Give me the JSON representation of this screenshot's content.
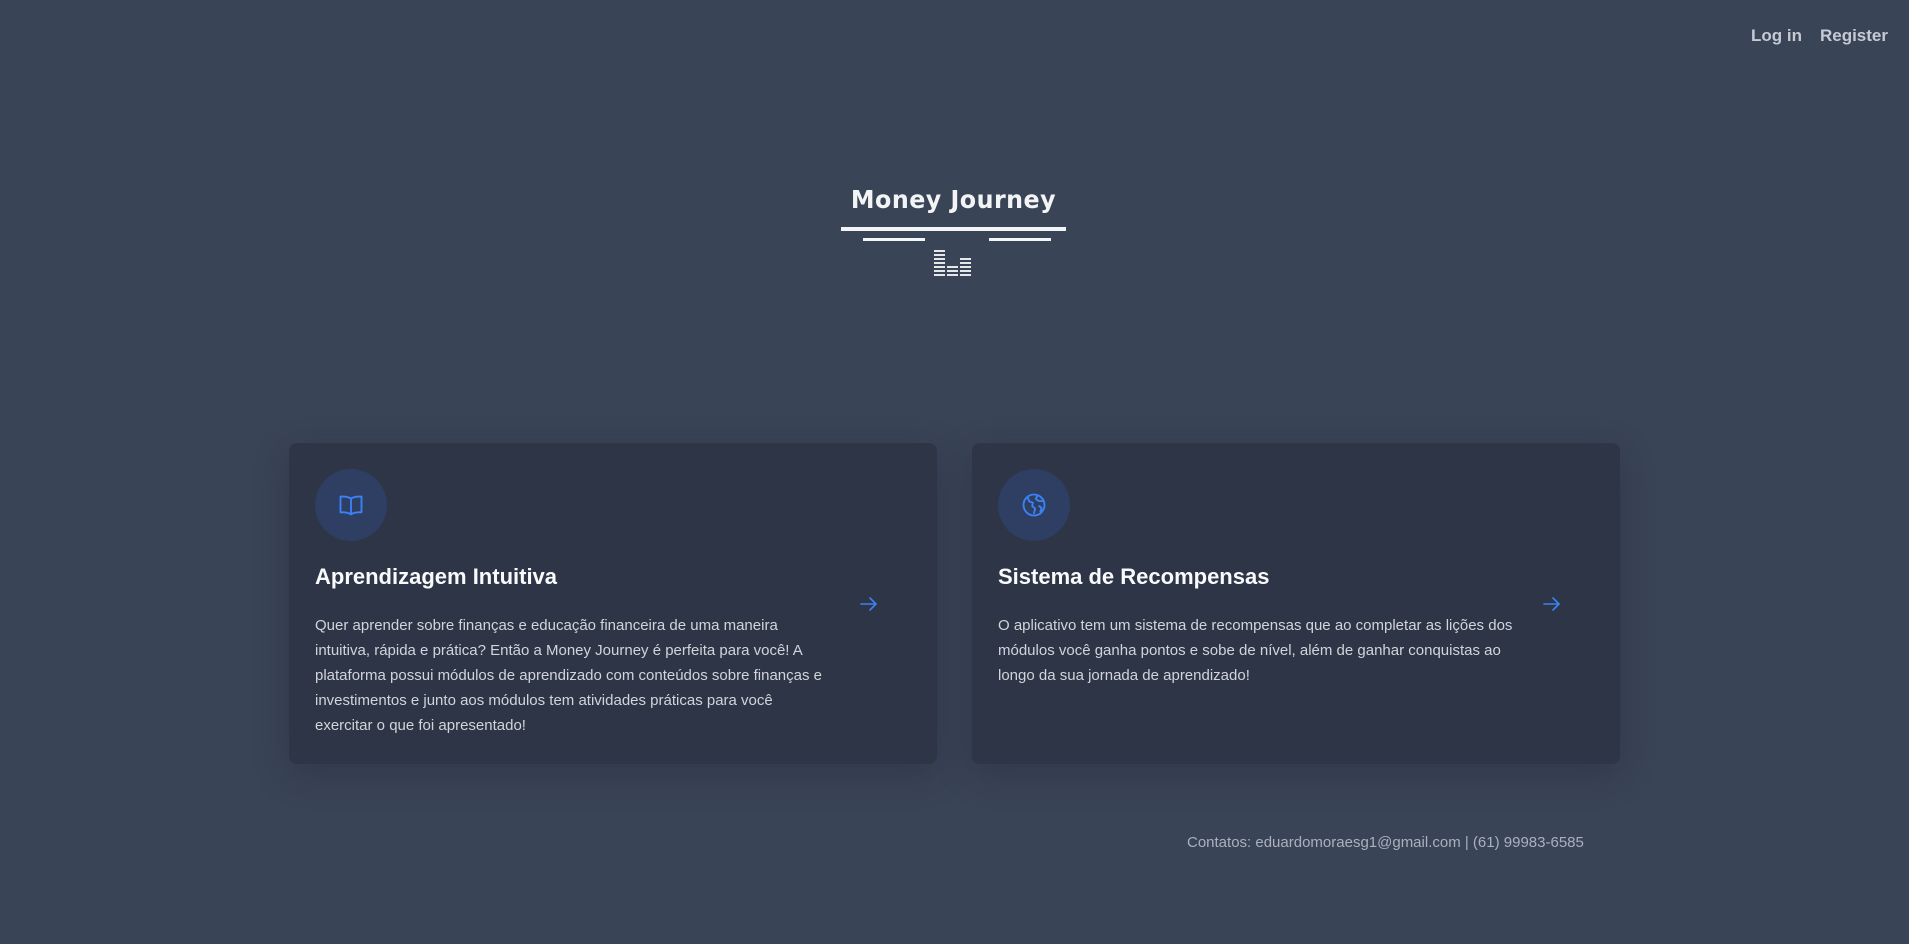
{
  "nav": {
    "login": "Log in",
    "register": "Register"
  },
  "logo": {
    "title": "Money Journey"
  },
  "cards": [
    {
      "icon": "book-open-icon",
      "title": "Aprendizagem Intuitiva",
      "text": "Quer aprender sobre finanças e educação financeira de uma maneira intuitiva, rápida e prática? Então a Money Journey é perfeita para você! A plataforma possui módulos de aprendizado com conteúdos sobre finanças e investimentos e junto aos módulos tem atividades práticas para você exercitar o que foi apresentado!"
    },
    {
      "icon": "globe-icon",
      "title": "Sistema de Recompensas",
      "text": "O aplicativo tem um sistema de recompensas que ao completar as lições dos módulos você ganha pontos e sobe de nível, além de ganhar conquistas ao longo da sua jornada de aprendizado!"
    }
  ],
  "footer": {
    "contacts": "Contatos: eduardomoraesg1@gmail.com | (61) 99983-6585"
  },
  "colors": {
    "background": "#3a4457",
    "card": "#2d3546",
    "accent": "#3b82f6",
    "icon_circle": "#2f3f63"
  }
}
